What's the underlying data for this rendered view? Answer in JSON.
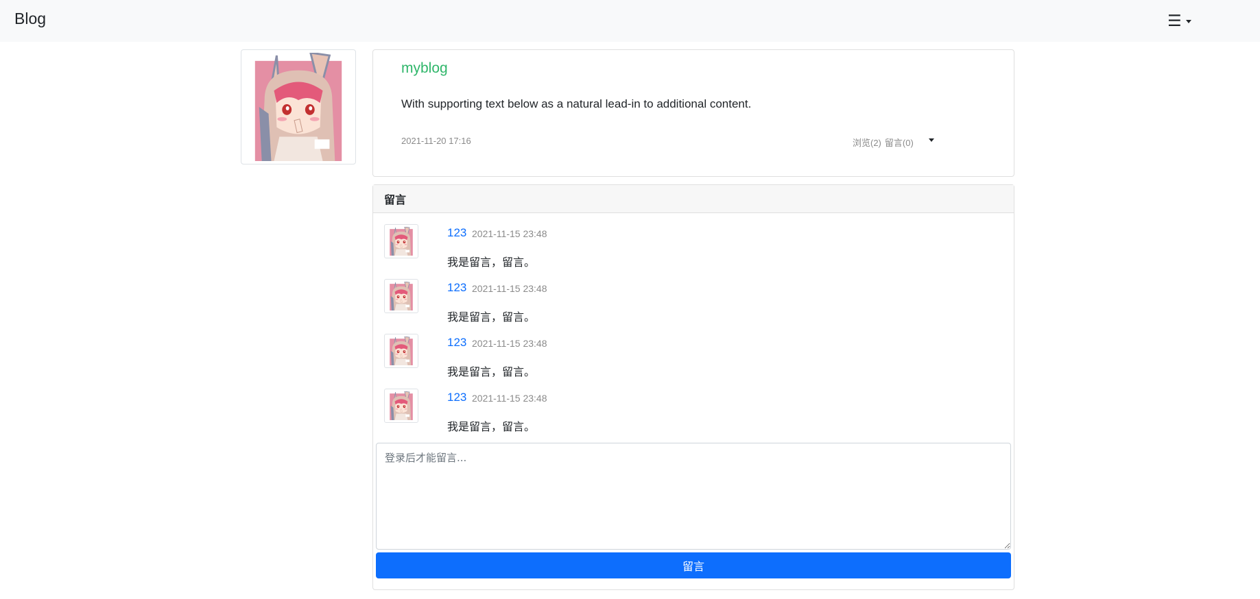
{
  "navbar": {
    "brand": "Blog",
    "menu_icon": "hamburger-menu-icon"
  },
  "post": {
    "title": "myblog",
    "text": "With supporting text below as a natural lead-in to additional content.",
    "date": "2021-11-20 17:16",
    "views": "浏览(2)",
    "comments_count": "留言(0)",
    "accent_color": "#2fb66a"
  },
  "comments": {
    "header": "留言",
    "items": [
      {
        "user": "123",
        "time": "2021-11-15 23:48",
        "text": "我是留言，留言。"
      },
      {
        "user": "123",
        "time": "2021-11-15 23:48",
        "text": "我是留言，留言。"
      },
      {
        "user": "123",
        "time": "2021-11-15 23:48",
        "text": "我是留言，留言。"
      },
      {
        "user": "123",
        "time": "2021-11-15 23:48",
        "text": "我是留言，留言。"
      }
    ],
    "input_placeholder": "登录后才能留言...",
    "submit_label": "留言",
    "button_color": "#0d6efd"
  }
}
